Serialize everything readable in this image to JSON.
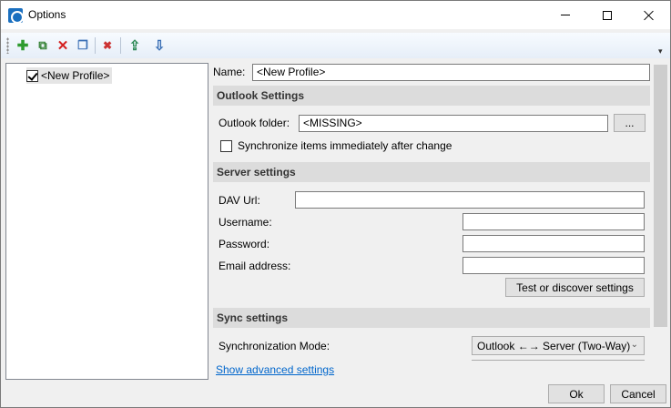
{
  "window": {
    "title": "Options",
    "icon": "app-sync-icon"
  },
  "toolbar": {
    "buttons": [
      {
        "name": "add-profile-icon",
        "glyph": "✚",
        "color": "#2e9b2e"
      },
      {
        "name": "add-multiple-profiles-icon",
        "glyph": "⧉",
        "color": "#2e7d2e"
      },
      {
        "name": "delete-profile-icon",
        "glyph": "✕",
        "color": "#d42020"
      },
      {
        "name": "copy-profile-icon",
        "glyph": "❐",
        "color": "#3a6fb5"
      },
      {
        "name": "clear-cache-icon",
        "glyph": "✖",
        "color": "#c33"
      },
      {
        "name": "export-profiles-icon",
        "glyph": "⇪",
        "color": "#2f8b58"
      },
      {
        "name": "import-profiles-icon",
        "glyph": "⇩",
        "color": "#3a6fb5"
      }
    ],
    "overflow_glyph": "▾"
  },
  "tree": {
    "items": [
      {
        "label": "<New Profile>",
        "checked": true
      }
    ]
  },
  "profile": {
    "name_label": "Name:",
    "name_value": "<New Profile>"
  },
  "outlook": {
    "section_title": "Outlook Settings",
    "folder_label": "Outlook folder:",
    "folder_value": "<MISSING>",
    "browse_label": "...",
    "sync_immediately_label": "Synchronize items immediately after change",
    "sync_immediately_checked": false
  },
  "server": {
    "section_title": "Server settings",
    "dav_url_label": "DAV Url:",
    "dav_url_value": "",
    "username_label": "Username:",
    "username_value": "",
    "password_label": "Password:",
    "password_value": "",
    "email_label": "Email address:",
    "email_value": "",
    "test_button_label": "Test or discover settings"
  },
  "sync": {
    "section_title": "Sync settings",
    "mode_label": "Synchronization Mode:",
    "mode_value": "Outlook ←→ Server (Two-Way)",
    "mode_arrow": "⌄"
  },
  "advanced_link": "Show advanced settings",
  "footer": {
    "ok_label": "Ok",
    "cancel_label": "Cancel"
  }
}
